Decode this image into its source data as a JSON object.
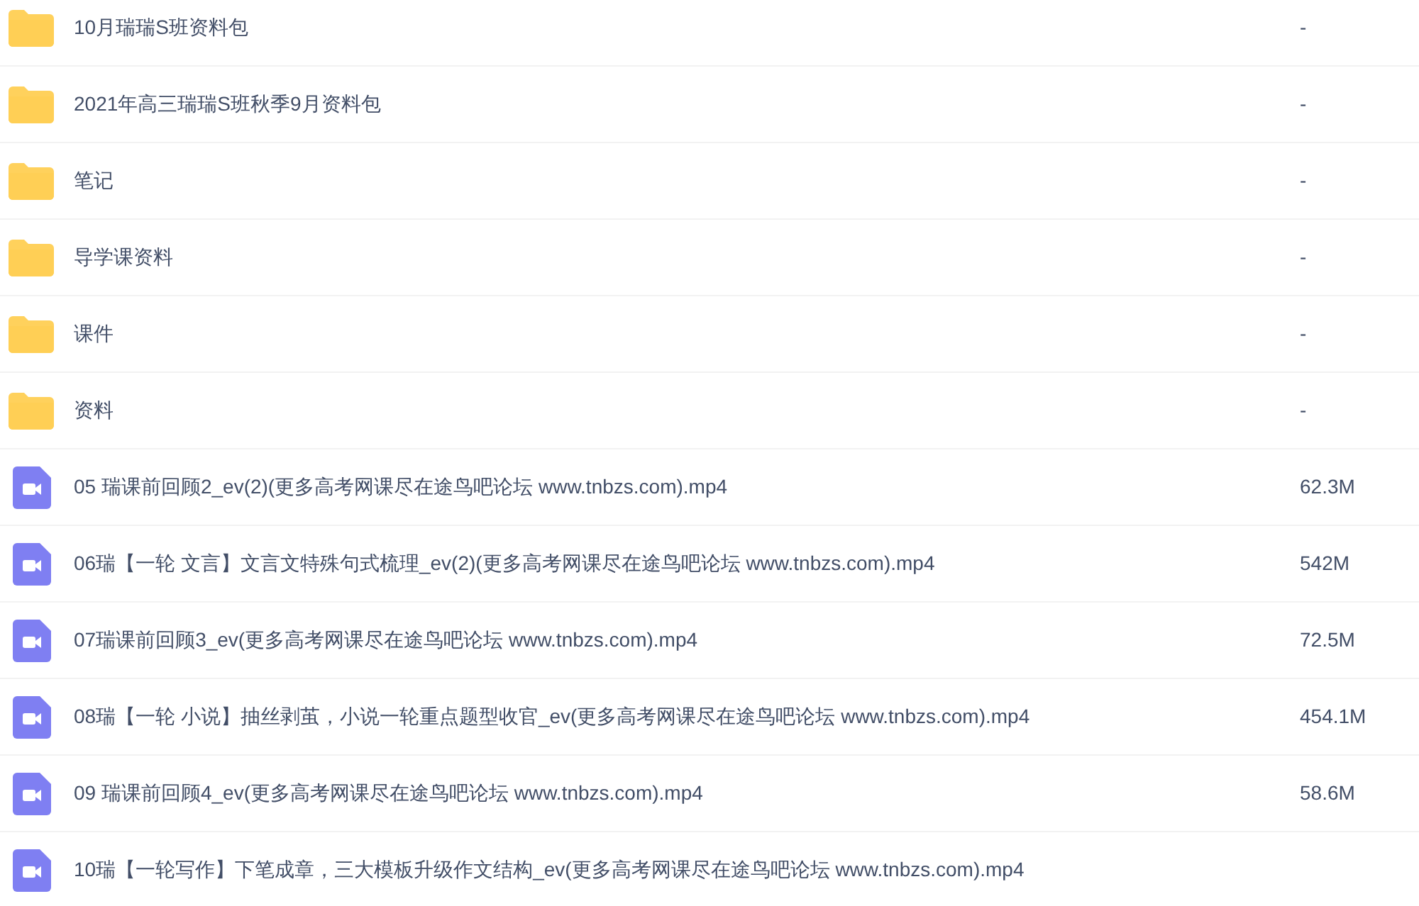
{
  "files": [
    {
      "kind": "folder",
      "name": "10月瑞瑞S班资料包",
      "size": "-"
    },
    {
      "kind": "folder",
      "name": "2021年高三瑞瑞S班秋季9月资料包",
      "size": "-"
    },
    {
      "kind": "folder",
      "name": "笔记",
      "size": "-"
    },
    {
      "kind": "folder",
      "name": "导学课资料",
      "size": "-"
    },
    {
      "kind": "folder",
      "name": "课件",
      "size": "-"
    },
    {
      "kind": "folder",
      "name": "资料",
      "size": "-"
    },
    {
      "kind": "video",
      "name": "05 瑞课前回顾2_ev(2)(更多高考网课尽在途鸟吧论坛 www.tnbzs.com).mp4",
      "size": "62.3M"
    },
    {
      "kind": "video",
      "name": "06瑞【一轮 文言】文言文特殊句式梳理_ev(2)(更多高考网课尽在途鸟吧论坛 www.tnbzs.com).mp4",
      "size": "542M"
    },
    {
      "kind": "video",
      "name": "07瑞课前回顾3_ev(更多高考网课尽在途鸟吧论坛 www.tnbzs.com).mp4",
      "size": "72.5M"
    },
    {
      "kind": "video",
      "name": "08瑞【一轮 小说】抽丝剥茧，小说一轮重点题型收官_ev(更多高考网课尽在途鸟吧论坛 www.tnbzs.com).mp4",
      "size": "454.1M"
    },
    {
      "kind": "video",
      "name": "09 瑞课前回顾4_ev(更多高考网课尽在途鸟吧论坛 www.tnbzs.com).mp4",
      "size": "58.6M"
    },
    {
      "kind": "video",
      "name": "10瑞【一轮写作】下笔成章，三大模板升级作文结构_ev(更多高考网课尽在途鸟吧论坛 www.tnbzs.com).mp4"
    }
  ]
}
